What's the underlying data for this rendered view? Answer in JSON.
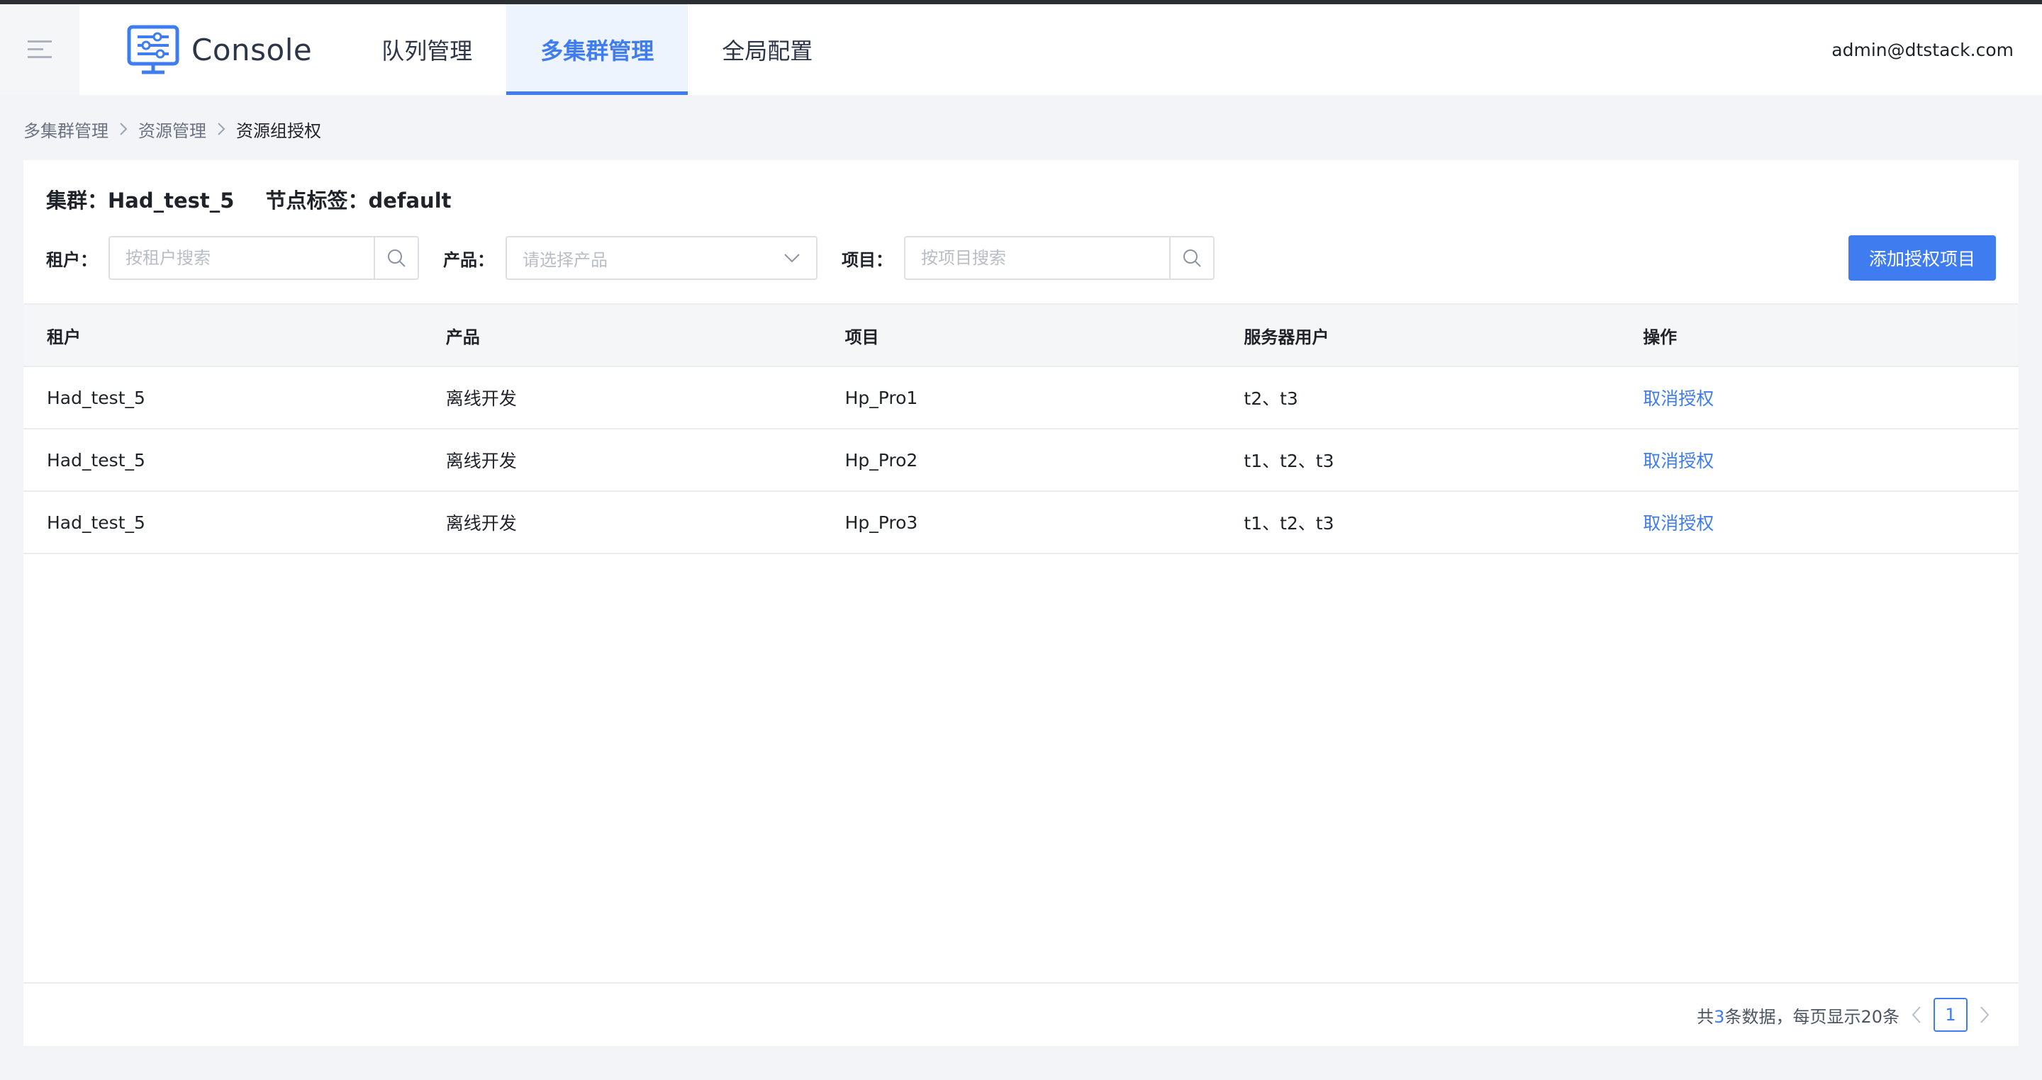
{
  "header": {
    "brand": "Console",
    "tabs": [
      {
        "label": "队列管理",
        "active": false
      },
      {
        "label": "多集群管理",
        "active": true
      },
      {
        "label": "全局配置",
        "active": false
      }
    ],
    "user": "admin@dtstack.com"
  },
  "breadcrumb": {
    "items": [
      "多集群管理",
      "资源管理",
      "资源组授权"
    ]
  },
  "card": {
    "cluster_label": "集群：Had_test_5",
    "node_label": "节点标签：default"
  },
  "filters": {
    "tenant_label": "租户：",
    "tenant_placeholder": "按租户搜索",
    "product_label": "产品：",
    "product_placeholder": "请选择产品",
    "project_label": "项目：",
    "project_placeholder": "按项目搜索",
    "add_button": "添加授权项目"
  },
  "table": {
    "columns": [
      "租户",
      "产品",
      "项目",
      "服务器用户",
      "操作"
    ],
    "rows": [
      {
        "tenant": "Had_test_5",
        "product": "离线开发",
        "project": "Hp_Pro1",
        "users": "t2、t3",
        "action": "取消授权"
      },
      {
        "tenant": "Had_test_5",
        "product": "离线开发",
        "project": "Hp_Pro2",
        "users": "t1、t2、t3",
        "action": "取消授权"
      },
      {
        "tenant": "Had_test_5",
        "product": "离线开发",
        "project": "Hp_Pro3",
        "users": "t1、t2、t3",
        "action": "取消授权"
      }
    ]
  },
  "pagination": {
    "prefix": "共",
    "count": "3",
    "suffix": "条数据，每页显示20条",
    "current_page": "1"
  },
  "colors": {
    "primary": "#3f7cf0",
    "header_bg": "#ffffff",
    "page_bg": "#f2f4f7"
  },
  "icons": [
    "menu-icon",
    "console-logo-icon",
    "search-icon",
    "chevron-down-icon",
    "chevron-left-icon",
    "chevron-right-icon",
    "breadcrumb-separator-icon"
  ]
}
